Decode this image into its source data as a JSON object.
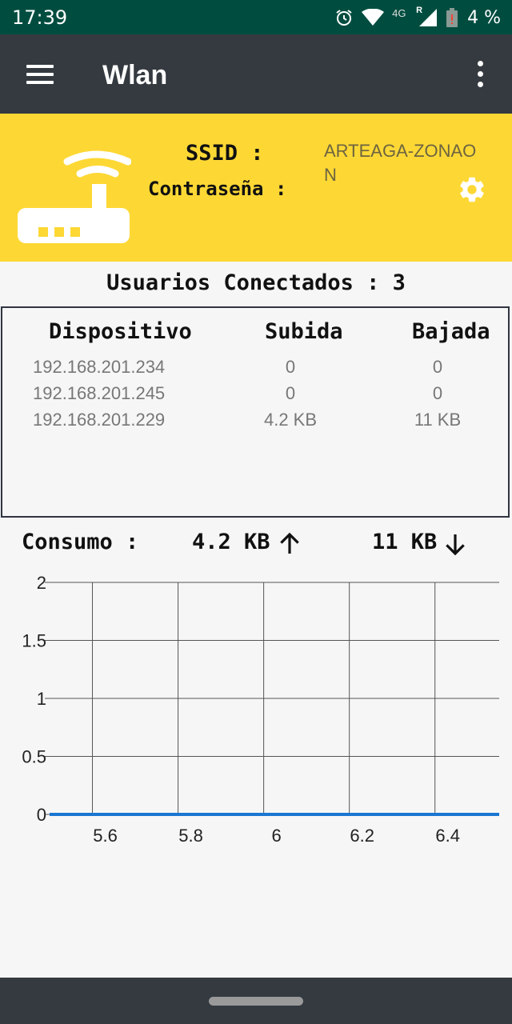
{
  "status_bar": {
    "time": "17:39",
    "network": "4G",
    "roaming": "R",
    "battery": "4 %",
    "icons": [
      "alarm-icon",
      "wifi-icon",
      "cell-signal-icon",
      "battery-icon"
    ]
  },
  "app_bar": {
    "title": "Wlan",
    "icons": [
      "menu-icon",
      "more-vert-icon"
    ],
    "color": "#343A40"
  },
  "hotspot": {
    "ssid_label": "SSID :",
    "password_label": "Contraseña :",
    "ssid_value": "ARTEAGA-ZONAON",
    "icons": [
      "router-icon",
      "settings-icon"
    ],
    "color": "#FDD835"
  },
  "users": {
    "title": "Usuarios Conectados : 3"
  },
  "devices": {
    "headers": [
      "Dispositivo",
      "Subida",
      "Bajada"
    ],
    "rows": [
      {
        "ip": "192.168.201.234",
        "up": "0",
        "down": "0"
      },
      {
        "ip": "192.168.201.245",
        "up": "0",
        "down": "0"
      },
      {
        "ip": "192.168.201.229",
        "up": "4.2 KB",
        "down": "11 KB"
      }
    ]
  },
  "consumption": {
    "label": "Consumo :",
    "upload": "4.2 KB",
    "download": "11 KB",
    "icons": [
      "arrow-up-icon",
      "arrow-down-icon"
    ]
  },
  "chart_data": {
    "type": "line",
    "x_ticks": [
      "5.6",
      "5.8",
      "6",
      "6.2",
      "6.4"
    ],
    "y_ticks": [
      "0",
      "0.5",
      "1",
      "1.5",
      "2"
    ],
    "xlim": [
      5.5,
      6.55
    ],
    "ylim": [
      0,
      2
    ],
    "grid": true,
    "series": [
      {
        "x": [
          5.5,
          6.55
        ],
        "y": [
          0,
          0
        ],
        "color": "#1976D2"
      }
    ]
  }
}
